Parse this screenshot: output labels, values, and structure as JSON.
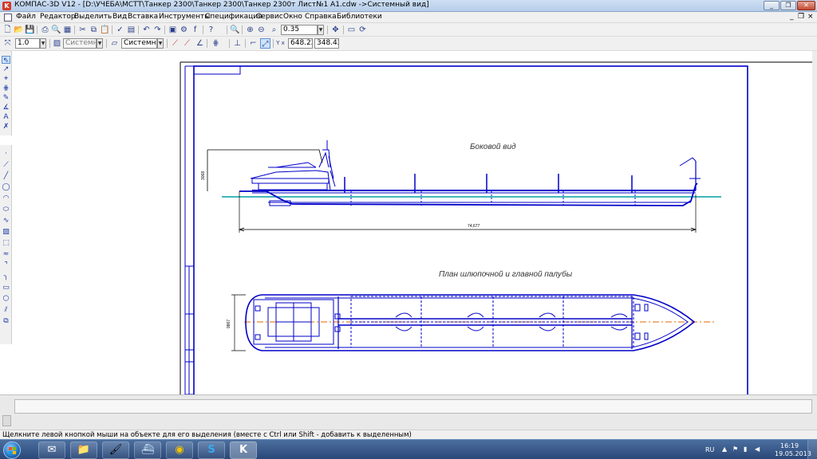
{
  "window": {
    "title": "КОМПАС-3D V12 - [D:\\УЧЕБА\\МСТТ\\Танкер 2300\\Танкер 2300\\Танкер 2300т Лист№1 А1.cdw ->Системный вид]",
    "app_icon": "K",
    "minimize_label": "_",
    "restore_label": "❐",
    "close_label": "✕"
  },
  "menu": {
    "items": [
      "Файл",
      "Редактор",
      "Выделить",
      "Вид",
      "Вставка",
      "Инструменты",
      "Спецификация",
      "Сервис",
      "Окно",
      "Справка",
      "Библиотеки"
    ],
    "mdi_minimize": "_",
    "mdi_restore": "❐",
    "mdi_close": "×"
  },
  "toolbar": {
    "zoom_value": "0.35",
    "line_scale": "1.0",
    "layer_style_1": "Системны",
    "layer_style_2": "Системный",
    "coord_label": "Y\nx",
    "coord_x": "648.22",
    "coord_y": "348.42"
  },
  "drawing": {
    "side_view_title": "Боковой вид",
    "plan_view_title": "План шлюпочной и главной палубы",
    "dim_length": "74,677",
    "dim_height": "3068",
    "dim_beam": "9867"
  },
  "status": {
    "hint": "Щелкните левой кнопкой мыши на объекте для его выделения (вместе с Ctrl или Shift - добавить к выделенным)"
  },
  "taskbar": {
    "apps": [
      {
        "name": "mail",
        "glyph": "✉"
      },
      {
        "name": "explorer",
        "glyph": "📁"
      },
      {
        "name": "paint",
        "glyph": "🖌"
      },
      {
        "name": "ship",
        "glyph": "⛴"
      },
      {
        "name": "chrome",
        "glyph": "◉"
      },
      {
        "name": "skype",
        "glyph": "S"
      },
      {
        "name": "kompas",
        "glyph": "K"
      }
    ],
    "language": "RU",
    "time": "16:19",
    "date": "19.05.2013"
  },
  "colors": {
    "drawing_blue": "#0000c8",
    "waterline": "#00a0a0",
    "axis": "#e06a00"
  }
}
